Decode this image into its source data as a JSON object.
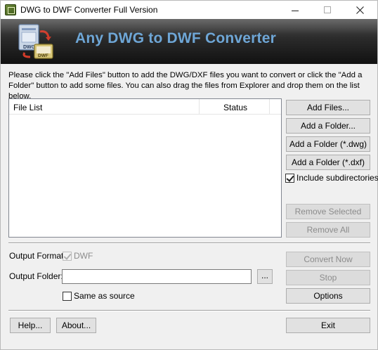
{
  "window": {
    "title": "DWG to DWF Converter Full Version"
  },
  "banner": {
    "title": "Any DWG to DWF Converter",
    "logo_icon": "dwg-to-dwf-logo-icon",
    "logo_labels": [
      "DWG",
      "DWF"
    ]
  },
  "instructions": "Please click the \"Add Files\" button to add the DWG/DXF files you want to convert or click the \"Add a Folder\" button to add some files. You can also drag the files from Explorer and drop them on the list below.",
  "file_list": {
    "columns": [
      "File List",
      "Status"
    ],
    "rows": []
  },
  "side_buttons": {
    "add_files": "Add Files...",
    "add_folder": "Add a Folder...",
    "add_folder_dwg": "Add a Folder (*.dwg)",
    "add_folder_dxf": "Add a Folder (*.dxf)",
    "include_subdirectories": "Include subdirectories",
    "include_subdirectories_checked": true,
    "remove_selected": "Remove Selected",
    "remove_all": "Remove All"
  },
  "output": {
    "format_label": "Output Format:",
    "format_value": "DWF",
    "format_checked": true,
    "folder_label": "Output Folder:",
    "folder_value": "",
    "browse_label": "...",
    "same_as_source": "Same as source",
    "same_as_source_checked": false
  },
  "actions": {
    "convert_now": "Convert Now",
    "stop": "Stop",
    "options": "Options"
  },
  "footer": {
    "help": "Help...",
    "about": "About...",
    "exit": "Exit"
  },
  "colors": {
    "banner_title": "#6ea6d6",
    "banner_bg": "#1f1f1f",
    "window_bg": "#f0f0f0"
  }
}
